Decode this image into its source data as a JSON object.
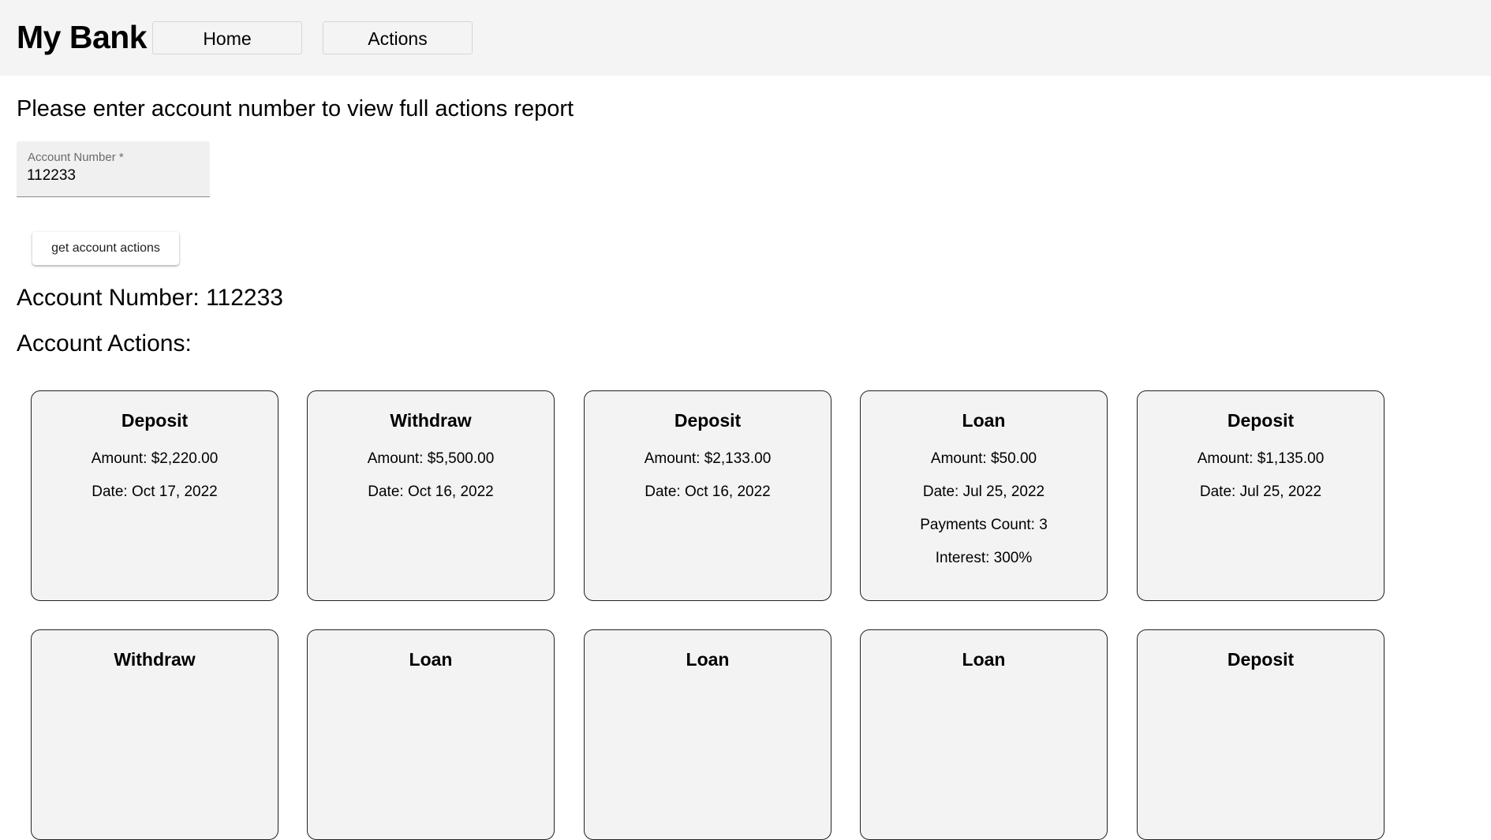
{
  "header": {
    "brand": "My Bank",
    "nav": [
      "Home",
      "Actions"
    ]
  },
  "form": {
    "prompt": "Please enter account number to view full actions report",
    "field_label": "Account Number *",
    "field_value": "112233",
    "submit_label": "get account actions"
  },
  "result": {
    "account_number_text": "Account Number: 112233",
    "actions_heading": "Account Actions:",
    "cards": [
      {
        "type": "Deposit",
        "lines": [
          "Amount: $2,220.00",
          "Date: Oct 17, 2022"
        ]
      },
      {
        "type": "Withdraw",
        "lines": [
          "Amount: $5,500.00",
          "Date: Oct 16, 2022"
        ]
      },
      {
        "type": "Deposit",
        "lines": [
          "Amount: $2,133.00",
          "Date: Oct 16, 2022"
        ]
      },
      {
        "type": "Loan",
        "lines": [
          "Amount: $50.00",
          "Date: Jul 25, 2022",
          "Payments Count: 3",
          "Interest: 300%"
        ]
      },
      {
        "type": "Deposit",
        "lines": [
          "Amount: $1,135.00",
          "Date: Jul 25, 2022"
        ]
      },
      {
        "type": "Withdraw",
        "lines": []
      },
      {
        "type": "Loan",
        "lines": []
      },
      {
        "type": "Loan",
        "lines": []
      },
      {
        "type": "Loan",
        "lines": []
      },
      {
        "type": "Deposit",
        "lines": []
      }
    ]
  }
}
